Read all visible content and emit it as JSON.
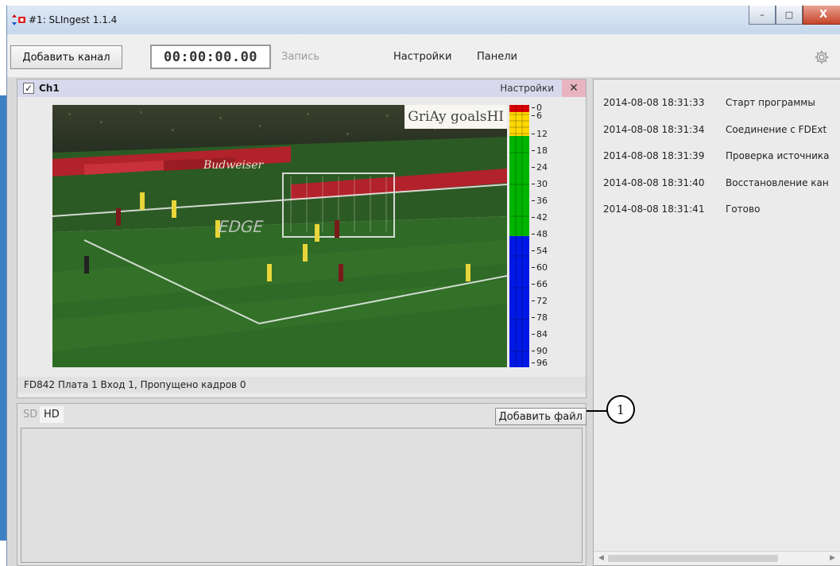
{
  "window": {
    "title": "#1: SLIngest 1.1.4",
    "controls": {
      "minimize": "–",
      "maximize": "□",
      "close": "X"
    }
  },
  "toolbar": {
    "add_channel": "Добавить канал",
    "timecode": "00:00:00.00",
    "record": "Запись",
    "settings": "Настройки",
    "panels": "Панели",
    "gear_icon": "gear-icon"
  },
  "channel": {
    "checked": true,
    "name": "Ch1",
    "settings": "Настройки",
    "close": "✕",
    "overlay_text": "GriAy goalsHI",
    "meter_scale": [
      "0",
      "6",
      "12",
      "18",
      "24",
      "30",
      "36",
      "42",
      "48",
      "54",
      "60",
      "66",
      "72",
      "78",
      "84",
      "90",
      "96"
    ],
    "colors": {
      "red": "#e60000",
      "yellow": "#ffd800",
      "green": "#00b400",
      "blue": "#0018e6"
    },
    "status": "FD842 Плата 1 Вход 1,  Пропущено кадров 0"
  },
  "files": {
    "tabs": [
      "SD",
      "HD"
    ],
    "active_tab": "HD",
    "add_file": "Добавить файл"
  },
  "log": [
    {
      "time": "2014-08-08 18:31:33",
      "message": "Старт программы"
    },
    {
      "time": "2014-08-08 18:31:34",
      "message": "Соединение с FDExt"
    },
    {
      "time": "2014-08-08 18:31:39",
      "message": "Проверка источника"
    },
    {
      "time": "2014-08-08 18:31:40",
      "message": "Восстановление кан"
    },
    {
      "time": "2014-08-08 18:31:41",
      "message": "Готово"
    }
  ],
  "callout": {
    "number": "1"
  }
}
